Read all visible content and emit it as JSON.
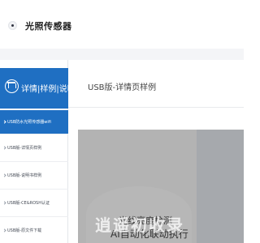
{
  "header": {
    "site_title": "光照传感器"
  },
  "sidebar": {
    "title": "详情|样例|说明",
    "items": [
      {
        "label": "USB防水光照传感器wifi",
        "active": true
      },
      {
        "label": "USB版-详情页样例",
        "active": false
      },
      {
        "label": "USB版-说明书样例",
        "active": false
      },
      {
        "label": "USB版-CE&ROSH认证",
        "active": false
      },
      {
        "label": "USB版-原文件下载",
        "active": false
      }
    ]
  },
  "main": {
    "heading": "USB版-详情页样例",
    "banner_line1": "光线亮度检测",
    "banner_line2": "AI自动化联动执行"
  },
  "watermark": "逍遥初收录"
}
